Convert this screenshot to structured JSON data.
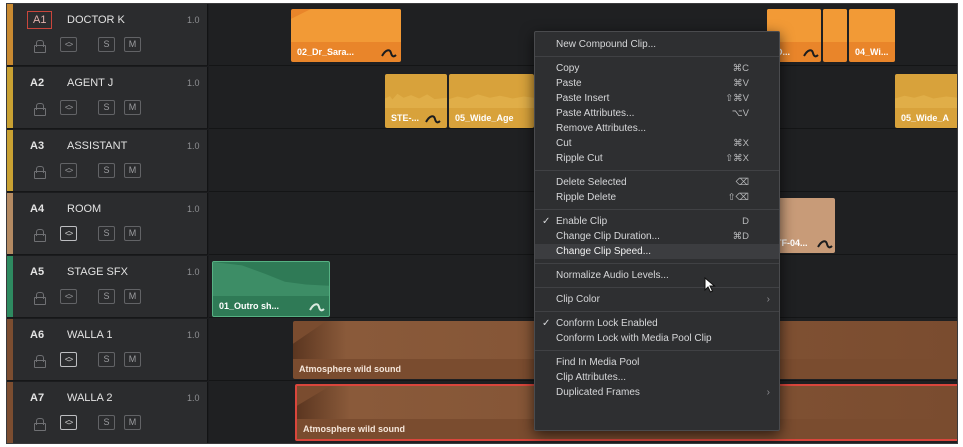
{
  "tracks": [
    {
      "id": "A1",
      "name": "DOCTOR K",
      "volume": "1.0",
      "stripe": "#c98a31",
      "boxed": true,
      "btn1_on": false
    },
    {
      "id": "A2",
      "name": "AGENT J",
      "volume": "1.0",
      "stripe": "#c9a132",
      "boxed": false,
      "btn1_on": false
    },
    {
      "id": "A3",
      "name": "ASSISTANT",
      "volume": "1.0",
      "stripe": "#c9a132",
      "boxed": false,
      "btn1_on": false
    },
    {
      "id": "A4",
      "name": "ROOM",
      "volume": "1.0",
      "stripe": "#b48a62",
      "boxed": false,
      "btn1_on": true
    },
    {
      "id": "A5",
      "name": "STAGE SFX",
      "volume": "1.0",
      "stripe": "#2e8a60",
      "boxed": false,
      "btn1_on": false
    },
    {
      "id": "A6",
      "name": "WALLA 1",
      "volume": "1.0",
      "stripe": "#7b4d30",
      "boxed": false,
      "btn1_on": true
    },
    {
      "id": "A7",
      "name": "WALLA 2",
      "volume": "1.0",
      "stripe": "#7b4d30",
      "boxed": false,
      "btn1_on": true
    }
  ],
  "track_buttons": {
    "solo": "S",
    "mute": "M",
    "link": "<>"
  },
  "clips": {
    "a1_left": "02_Dr_Sara...",
    "a1_right_partial": "D...",
    "a1_right": "04_Wi...",
    "a2_ste": "STE-...",
    "a2_wide": "05_Wide_Age",
    "a2_right": "05_Wide_A",
    "a4_partial": "TF-04...",
    "a5_outro": "01_Outro sh...",
    "a6_atmos": "Atmosphere wild sound",
    "a7_atmos": "Atmosphere wild sound"
  },
  "colors": {
    "orange": "#e9852a",
    "yellow": "#d8a23b",
    "green": "#2f7a56",
    "tan": "#c89b78",
    "brown": "#7a4c2f",
    "selection": "#d9463c"
  },
  "context_menu": {
    "new_compound": "New Compound Clip...",
    "copy": "Copy",
    "copy_sc": "⌘C",
    "paste": "Paste",
    "paste_sc": "⌘V",
    "paste_insert": "Paste Insert",
    "paste_insert_sc": "⇧⌘V",
    "paste_attributes": "Paste Attributes...",
    "paste_attributes_sc": "⌥V",
    "remove_attributes": "Remove Attributes...",
    "cut": "Cut",
    "cut_sc": "⌘X",
    "ripple_cut": "Ripple Cut",
    "ripple_cut_sc": "⇧⌘X",
    "delete_selected": "Delete Selected",
    "delete_selected_sc": "⌫",
    "ripple_delete": "Ripple Delete",
    "ripple_delete_sc": "⇧⌫",
    "enable_clip": "Enable Clip",
    "enable_clip_sc": "D",
    "enable_clip_checked": "✓",
    "change_duration": "Change Clip Duration...",
    "change_duration_sc": "⌘D",
    "change_speed": "Change Clip Speed...",
    "normalize": "Normalize Audio Levels...",
    "clip_color": "Clip Color",
    "conform_lock": "Conform Lock Enabled",
    "conform_lock_checked": "✓",
    "conform_lock_pool": "Conform Lock with Media Pool Clip",
    "find_in_pool": "Find In Media Pool",
    "clip_attributes": "Clip Attributes...",
    "duplicated_frames": "Duplicated Frames",
    "submenu_arrow": "›"
  }
}
